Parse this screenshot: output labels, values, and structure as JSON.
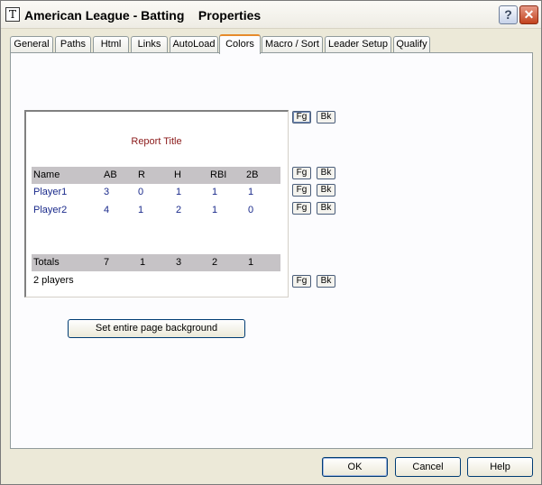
{
  "window": {
    "title": "American League - Batting    Properties",
    "icon_letter": "T",
    "help_glyph": "?",
    "close_glyph": "✕"
  },
  "tabs": [
    {
      "label": "General"
    },
    {
      "label": "Paths"
    },
    {
      "label": "Html"
    },
    {
      "label": "Links"
    },
    {
      "label": "AutoLoad"
    },
    {
      "label": "Colors",
      "active": true
    },
    {
      "label": "Macro / Sort"
    },
    {
      "label": "Leader Setup"
    },
    {
      "label": "Qualify"
    }
  ],
  "preview": {
    "report_title": "Report Title",
    "header": [
      "Name",
      "AB",
      "R",
      "H",
      "RBI",
      "2B"
    ],
    "rows": [
      [
        "Player1",
        "3",
        "0",
        "1",
        "1",
        "1"
      ],
      [
        "Player2",
        "4",
        "1",
        "2",
        "1",
        "0"
      ]
    ],
    "totals": [
      "Totals",
      "7",
      "1",
      "3",
      "2",
      "1"
    ],
    "footer": "2 players"
  },
  "color_buttons": {
    "fg": "Fg",
    "bk": "Bk"
  },
  "set_background_label": "Set entire page background",
  "buttons": {
    "ok": "OK",
    "cancel": "Cancel",
    "help": "Help"
  },
  "colors": {
    "report_title": "#8b1a1a",
    "player_text": "#1a2a8b",
    "grey_band": "#c6c3c6",
    "active_tab_accent": "#e68b2c"
  }
}
